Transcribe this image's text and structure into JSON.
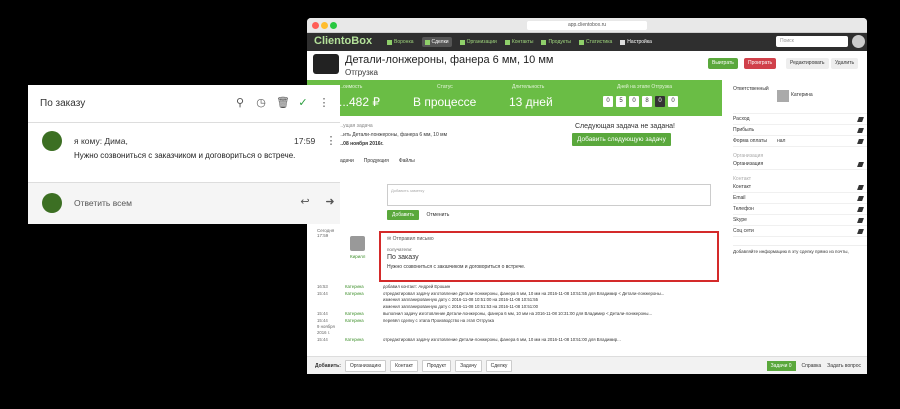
{
  "browser": {
    "url": "app.clientobox.ru"
  },
  "nav": {
    "logo": "ClientoBox",
    "items": [
      "Воронка",
      "Сделки",
      "Организации",
      "Контакты",
      "Продукты",
      "Статистика",
      "Настройка"
    ],
    "search_placeholder": "Поиск"
  },
  "deal": {
    "title": "Детали-лонжероны, фанера 6 мм, 10 мм",
    "subtitle": "Отгрузка",
    "buttons": [
      "Выиграть",
      "Проиграть",
      "Редактировать",
      "Удалить"
    ]
  },
  "progress": {
    "label1": "...оимость",
    "value1": "...482 ₽",
    "label2": "Статус",
    "value2": "В процессе",
    "label3": "Длительность",
    "value3": "13 дней",
    "label4": "Дней на этапе Отгрузка",
    "digits": [
      "0",
      "5",
      "0",
      "8",
      "0",
      "0"
    ]
  },
  "task": {
    "label": "...ущая задача",
    "desc": "...ить Детали-лонжероны, фанера 6 мм, 10 мм",
    "date": "...08 ноября 2016г.",
    "next": "Следующая задача не задана!",
    "next_btn": "Добавить следующую задачу"
  },
  "tabs": [
    "Задачи",
    "Продукция",
    "Файлы"
  ],
  "composer": {
    "placeholder": "Добавить заметку",
    "add": "Добавить",
    "cancel": "Отменить"
  },
  "feed": {
    "today": "Сегодня",
    "time": "17:59",
    "author": "Кирилл",
    "sent_label": "Отправил письмо",
    "recipient_label": "получатели:",
    "subject": "По заказу",
    "body": "Нужно созвониться с заказчиком и договориться о встрече."
  },
  "log": [
    {
      "t": "16:53",
      "who": "Катерина",
      "text": "добавил контакт: Андрей Ерошин"
    },
    {
      "t": "15:44",
      "who": "Катерина",
      "text": "отредактировал задачу изготовление Детали-лонжероны, фанера 6 мм, 10 мм на 2016-11-08 10:51:55 для Владимир < Детали-лонжероны..."
    },
    {
      "t": "",
      "who": "",
      "text": "изменил запланированную дату с 2016-11-08 10:51:00 на 2016-11-08 10:51:55"
    },
    {
      "t": "",
      "who": "",
      "text": "изменил запланированную дату с 2016-11-08 10:51:53 на 2016-11-08 10:51:00"
    },
    {
      "t": "15:44",
      "who": "Катерина",
      "text": "выполнил задачу изготовление Детали-лонжероны, фанера 6 мм, 10 мм на 2016-11-08 10:31:00 для Владимир < Детали-лонжероны..."
    },
    {
      "t": "15:44",
      "who": "Катерина",
      "text": "перевёл сделку с этапа Производство на этап Отгрузка"
    },
    {
      "t": "9 ноября 2016 г.",
      "who": "",
      "text": ""
    },
    {
      "t": "15:44",
      "who": "Катерина",
      "text": "отредактировал задачу изготовление Детали-лонжероны, фанера 6 мм, 10 мм на 2016-11-08 10:51:00 для Владимир..."
    }
  ],
  "right": {
    "owner_label": "Ответственный",
    "owner": "Катерина",
    "fields": [
      [
        "Расход",
        ""
      ],
      [
        "Прибыль",
        ""
      ],
      [
        "Форма оплаты",
        "нал"
      ]
    ],
    "org_header": "Организация",
    "org_label": "Организация",
    "contact_header": "Контакт",
    "contact_fields": [
      "Контакт",
      "Email",
      "Телефон",
      "Skype",
      "Соц сети"
    ],
    "info": "Добавляйте информацию в эту сделку прямо из почты,"
  },
  "bottom": {
    "label": "Добавить:",
    "buttons": [
      "Организацию",
      "Контакт",
      "Продукт",
      "Задачу",
      "Сделку"
    ],
    "tasks": "Задачи",
    "tasks_count": "0",
    "help": "Справка",
    "ask": "Задать вопрос"
  },
  "gmail": {
    "subject": "По заказу",
    "from": "я кому: Дима,",
    "time": "17:59",
    "body": "Нужно созвониться с заказчиком и договориться о встрече.",
    "reply_all": "Ответить всем"
  }
}
